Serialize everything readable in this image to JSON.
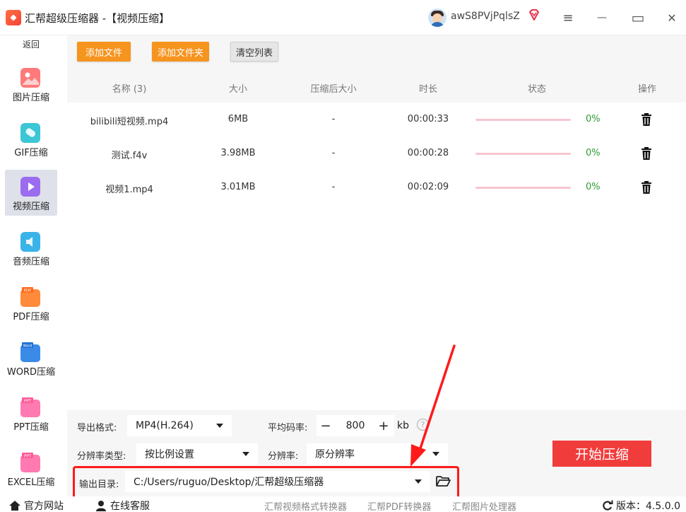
{
  "titlebar": {
    "app_title": "汇帮超级压缩器  -【视频压缩】",
    "username": "awS8PVjPqlsZ",
    "menu_glyph": "≡",
    "minimize_glyph": "—",
    "maximize_glyph": "▭",
    "close_glyph": "✕"
  },
  "sidebar": {
    "back_label": "返回",
    "items": [
      {
        "label": "图片压缩",
        "icon": "image-compress-icon",
        "color": "#ff7a7a"
      },
      {
        "label": "GIF压缩",
        "icon": "gif-compress-icon",
        "color": "#3cc6d6"
      },
      {
        "label": "视频压缩",
        "icon": "video-compress-icon",
        "color": "#9b6cf0",
        "active": true
      },
      {
        "label": "音频压缩",
        "icon": "audio-compress-icon",
        "color": "#3ab3e8"
      },
      {
        "label": "PDF压缩",
        "icon": "pdf-compress-icon",
        "color": "#ff8a3c",
        "badge": "PDF"
      },
      {
        "label": "WORD压缩",
        "icon": "word-compress-icon",
        "color": "#3a8be8",
        "badge": "Word"
      },
      {
        "label": "PPT压缩",
        "icon": "ppt-compress-icon",
        "color": "#ff7ab0",
        "badge": "PPT"
      },
      {
        "label": "EXCEL压缩",
        "icon": "excel-compress-icon",
        "color": "#ff7ab0",
        "badge": "PPT"
      }
    ]
  },
  "toolbar": {
    "add_file": "添加文件",
    "add_folder": "添加文件夹",
    "clear_list": "清空列表"
  },
  "table": {
    "headers": {
      "name": "名称 (3)",
      "size": "大小",
      "compressed_size": "压缩后大小",
      "duration": "时长",
      "status": "状态",
      "action": "操作"
    },
    "rows": [
      {
        "name": "bilibili短视频.mp4",
        "size": "6MB",
        "compressed": "-",
        "duration": "00:00:33",
        "progress_pct": 0,
        "pct_label": "0%"
      },
      {
        "name": "测试.f4v",
        "size": "3.98MB",
        "compressed": "-",
        "duration": "00:00:28",
        "progress_pct": 0,
        "pct_label": "0%"
      },
      {
        "name": "视频1.mp4",
        "size": "3.01MB",
        "compressed": "-",
        "duration": "00:02:09",
        "progress_pct": 0,
        "pct_label": "0%"
      }
    ]
  },
  "settings": {
    "format_label": "导出格式:",
    "format_value": "MP4(H.264)",
    "bitrate_label": "平均码率:",
    "bitrate_value": "800",
    "bitrate_minus": "−",
    "bitrate_plus": "+",
    "bitrate_unit": "kb",
    "help_glyph": "?",
    "res_type_label": "分辨率类型:",
    "res_type_value": "按比例设置",
    "res_label": "分辨率:",
    "res_value": "原分辨率",
    "output_label": "输出目录:",
    "output_value": "C:/Users/ruguo/Desktop/汇帮超级压缩器",
    "start_button": "开始压缩"
  },
  "footer": {
    "website": "官方网站",
    "support": "在线客服",
    "link1": "汇帮视频格式转换器",
    "link2": "汇帮PDF转换器",
    "link3": "汇帮图片处理器",
    "version": "版本：4.5.0.0"
  },
  "colors": {
    "accent_orange": "#f69420",
    "start_red": "#f13c3c",
    "highlight_red": "#ff1a1a",
    "progress_pink": "#f7c5cf",
    "success_green": "#2e9b36"
  }
}
